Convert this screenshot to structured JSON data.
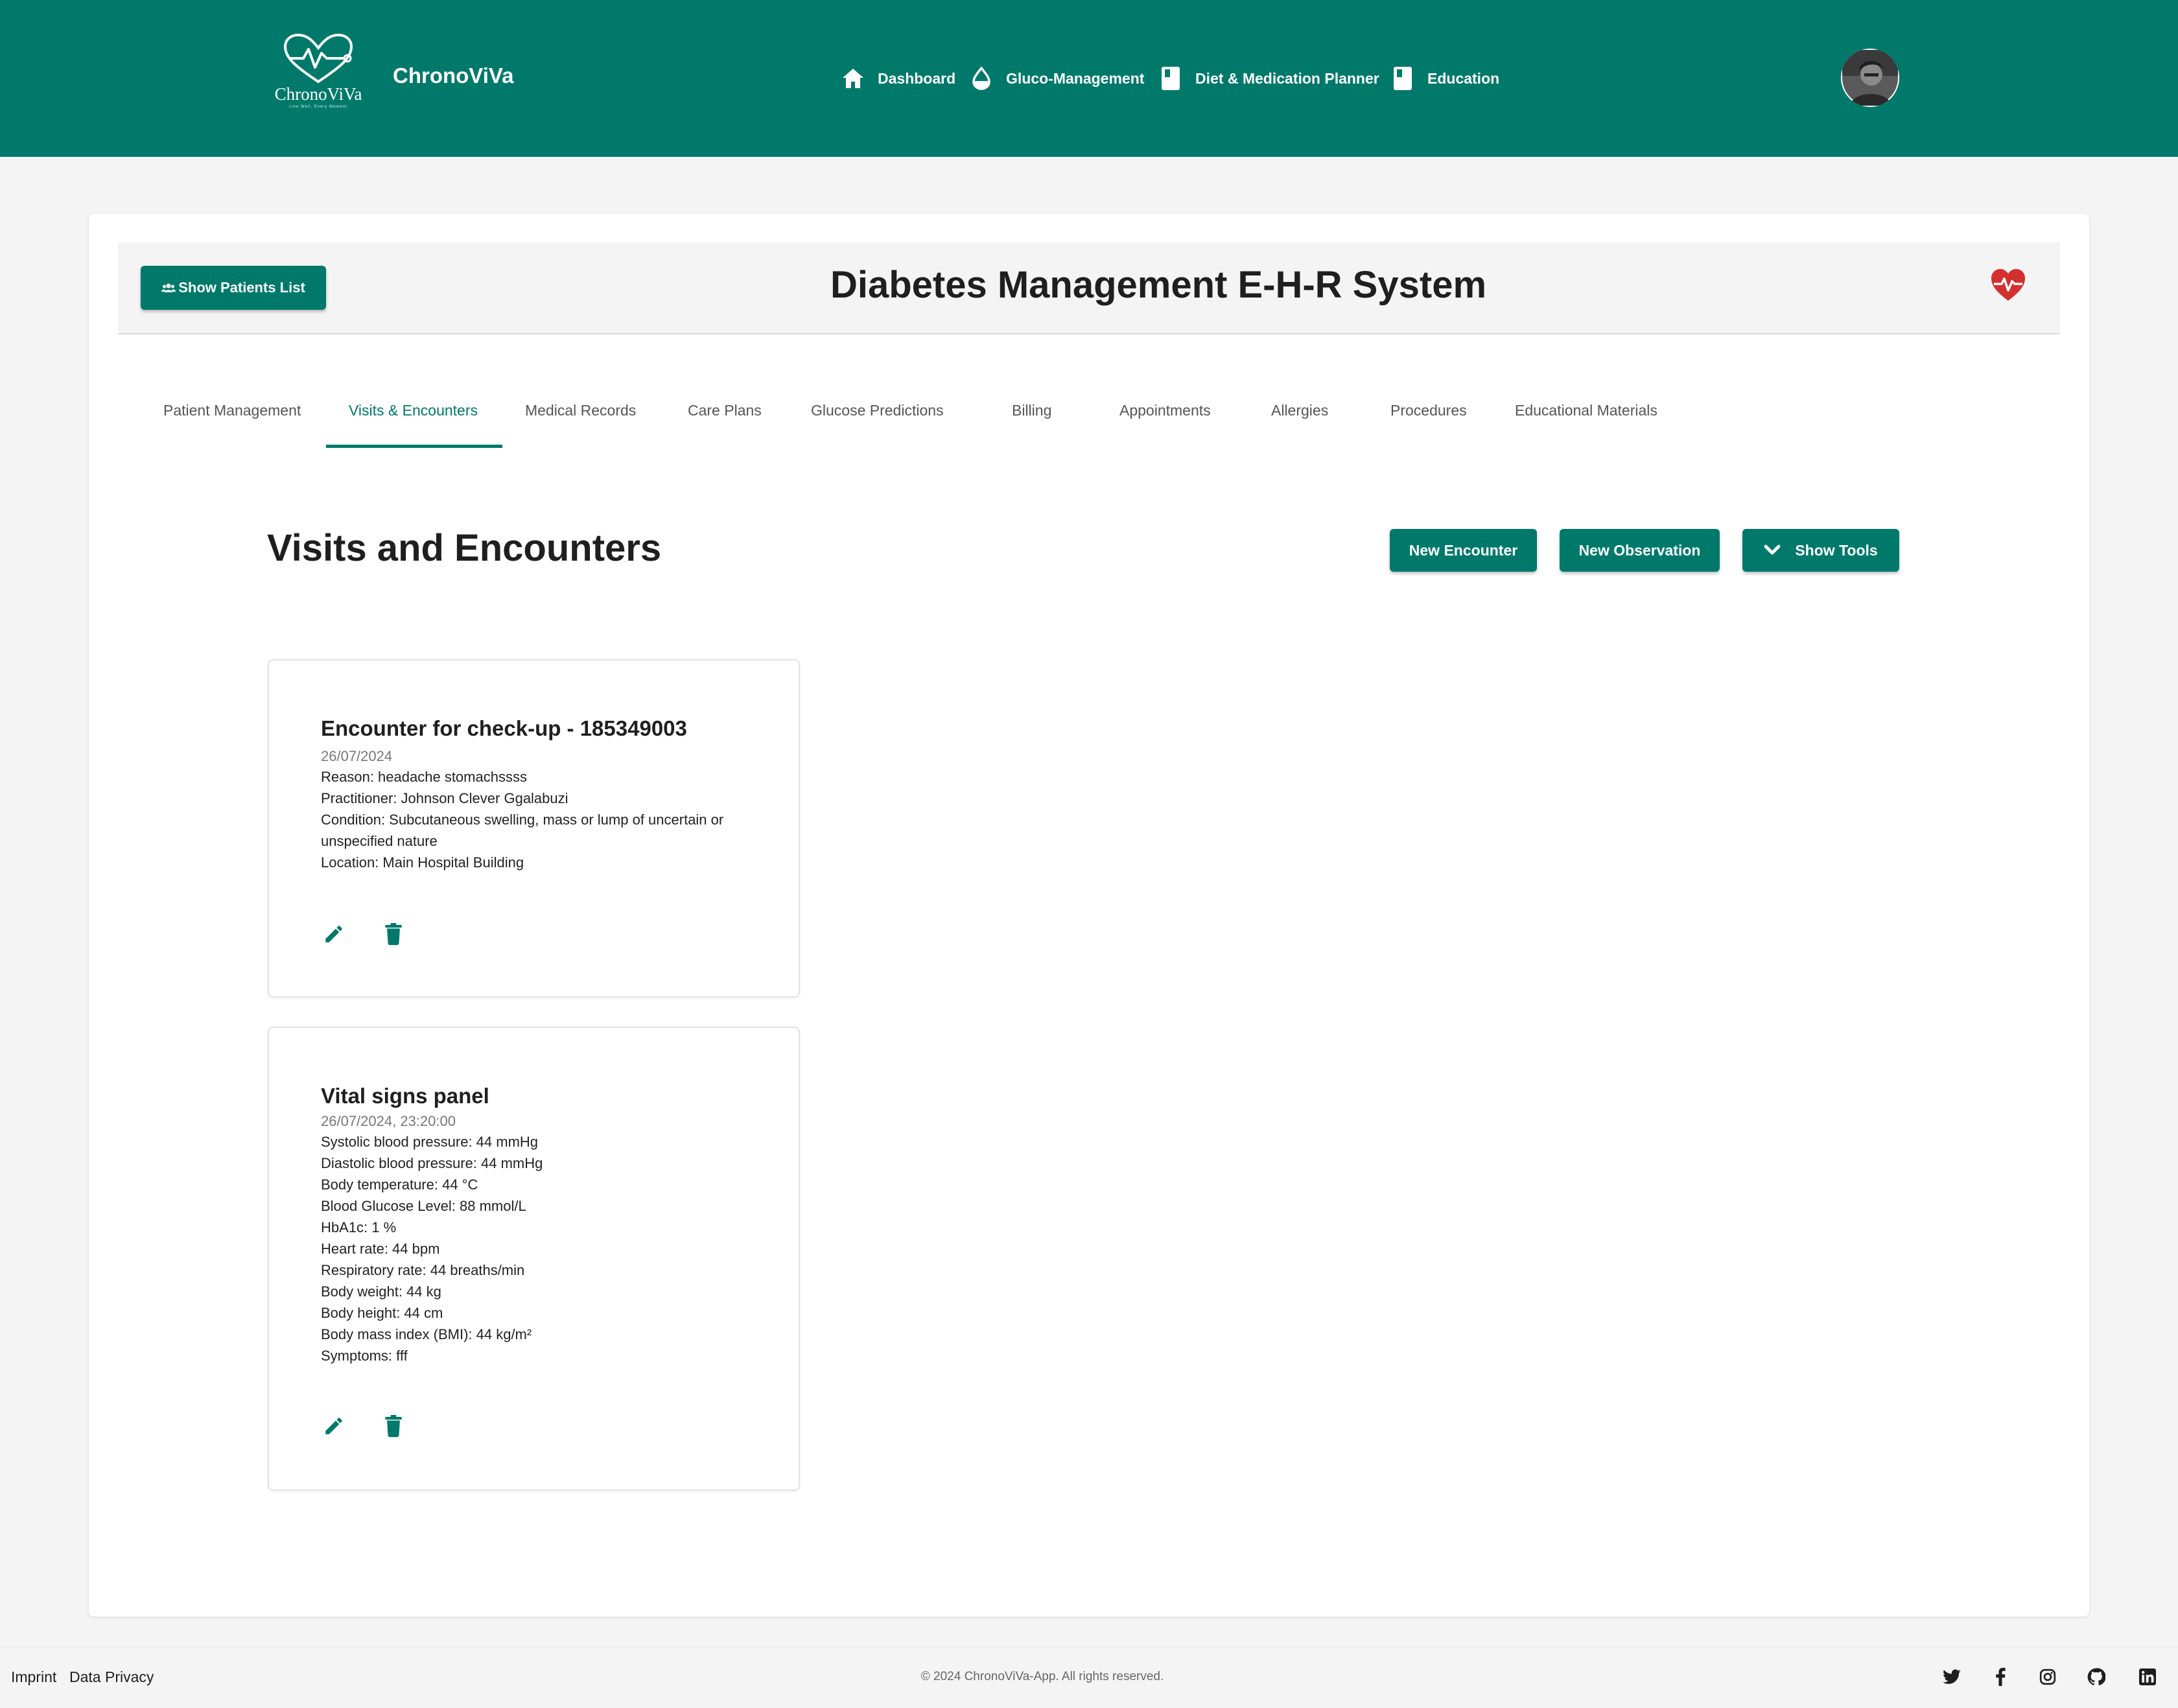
{
  "header": {
    "logo_text": "ChronoViVa",
    "logo_tagline": "Live Well, Every Moment",
    "brand": "ChronoViVa",
    "nav": [
      {
        "label": "Dashboard",
        "icon": "home-icon"
      },
      {
        "label": "Gluco-Management",
        "icon": "drop-icon"
      },
      {
        "label": "Diet & Medication Planner",
        "icon": "book-icon"
      },
      {
        "label": "Education",
        "icon": "book-icon"
      }
    ],
    "avatar": "user-avatar"
  },
  "ehr": {
    "show_patients_label": "Show Patients List",
    "title": "Diabetes Management E-H-R System"
  },
  "tabs": [
    {
      "label": "Patient Management"
    },
    {
      "label": "Visits & Encounters",
      "active": true
    },
    {
      "label": "Medical Records"
    },
    {
      "label": "Care Plans"
    },
    {
      "label": "Glucose Predictions"
    },
    {
      "label": "Billing"
    },
    {
      "label": "Appointments"
    },
    {
      "label": "Allergies"
    },
    {
      "label": "Procedures"
    },
    {
      "label": "Educational Materials"
    }
  ],
  "section": {
    "title": "Visits and Encounters",
    "new_encounter": "New Encounter",
    "new_observation": "New Observation",
    "show_tools": "Show Tools"
  },
  "encounter_card": {
    "title": "Encounter for check-up - 185349003",
    "date": "26/07/2024",
    "lines": [
      "Reason: headache stomachssss",
      "Practitioner: Johnson Clever Ggalabuzi",
      "Condition: Subcutaneous swelling, mass or lump of uncertain or unspecified nature",
      "Location: Main Hospital Building"
    ]
  },
  "vitals_card": {
    "title": "Vital signs panel",
    "date": "26/07/2024, 23:20:00",
    "lines": [
      "Systolic blood pressure: 44 mmHg",
      "Diastolic blood pressure: 44 mmHg",
      "Body temperature: 44 °C",
      "Blood Glucose Level: 88 mmol/L",
      "HbA1c: 1 %",
      "Heart rate: 44 bpm",
      "Respiratory rate: 44 breaths/min",
      "Body weight: 44 kg",
      "Body height: 44 cm",
      "Body mass index (BMI): 44 kg/m²",
      "Symptoms: fff"
    ]
  },
  "footer": {
    "imprint": "Imprint",
    "privacy": "Data Privacy",
    "copyright": "© 2024 ChronoViVa-App. All rights reserved.",
    "social": [
      "twitter-icon",
      "facebook-icon",
      "instagram-icon",
      "github-icon",
      "linkedin-icon"
    ]
  },
  "colors": {
    "primary": "#00796b",
    "heart": "#d32f2f",
    "background": "#f4f4f4"
  }
}
